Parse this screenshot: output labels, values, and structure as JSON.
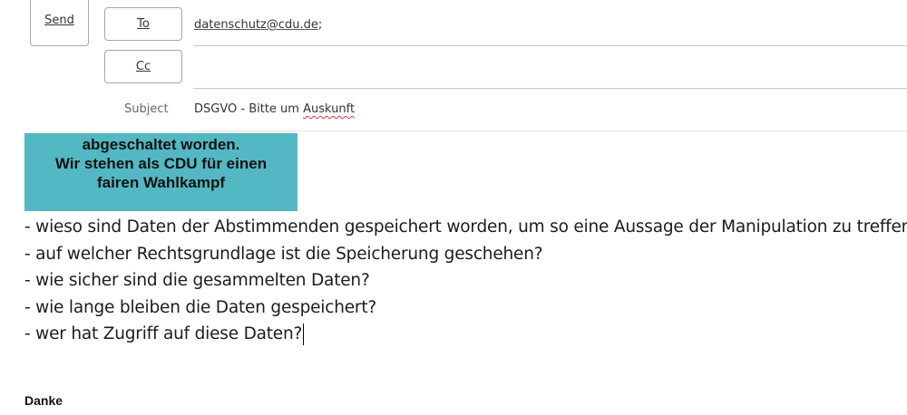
{
  "compose": {
    "send_label": "Send",
    "to_label": "To",
    "cc_label": "Cc",
    "to_value": "datenschutz@cdu.de",
    "to_separator": ";",
    "cc_value": "",
    "subject_label": "Subject",
    "subject_prefix": "DSGVO - Bitte um ",
    "subject_misspelled_word": "Auskunft"
  },
  "body": {
    "image_text": [
      "abgeschaltet worden.",
      "Wir stehen als CDU für einen",
      "fairen Wahlkampf"
    ],
    "questions": [
      "- wieso sind Daten der Abstimmenden gespeichert worden, um so eine Aussage der Manipulation zu treffen?",
      "- auf welcher Rechtsgrundlage ist die Speicherung geschehen?",
      "- wie sicher sind die gesammelten Daten?",
      "- wie lange bleiben die Daten gespeichert?",
      "- wer hat Zugriff auf diese Daten?"
    ],
    "closing": "Danke"
  },
  "colors": {
    "image_background": "#53b8c3",
    "spellcheck_underline": "#d23b3b"
  }
}
